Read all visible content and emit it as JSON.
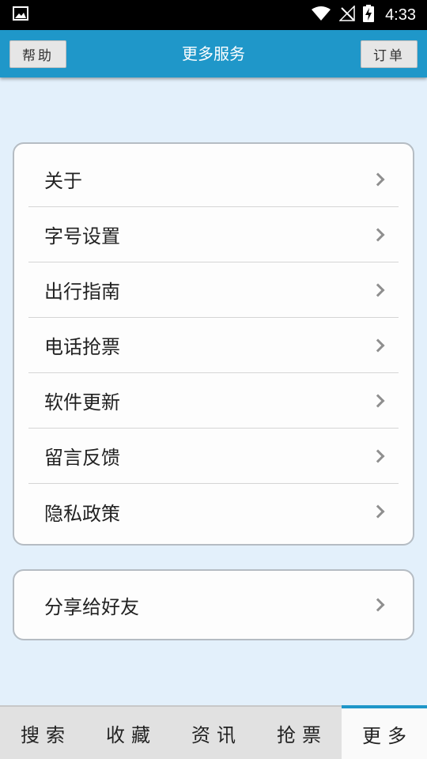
{
  "status_bar": {
    "time": "4:33",
    "icons": [
      "image-icon",
      "wifi-icon",
      "no-signal-icon",
      "battery-charging-icon"
    ]
  },
  "header": {
    "left_button": "帮助",
    "title": "更多服务",
    "right_button": "订单",
    "color": "#1f97c9"
  },
  "menu": {
    "items": [
      {
        "label": "关于"
      },
      {
        "label": "字号设置"
      },
      {
        "label": "出行指南"
      },
      {
        "label": "电话抢票"
      },
      {
        "label": "软件更新"
      },
      {
        "label": "留言反馈"
      },
      {
        "label": "隐私政策"
      }
    ]
  },
  "share": {
    "label": "分享给好友"
  },
  "tabs": [
    {
      "label": "搜索",
      "active": false
    },
    {
      "label": "收藏",
      "active": false
    },
    {
      "label": "资讯",
      "active": false
    },
    {
      "label": "抢票",
      "active": false
    },
    {
      "label": "更多",
      "active": true
    }
  ]
}
